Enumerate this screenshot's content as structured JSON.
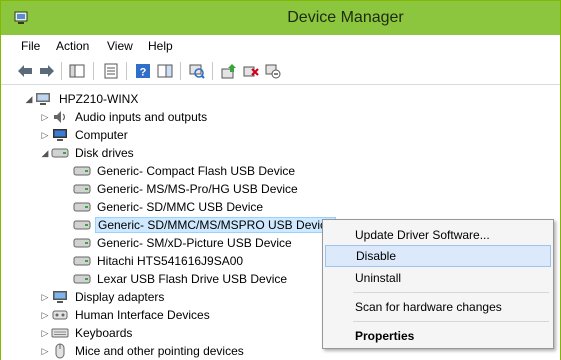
{
  "window": {
    "title": "Device Manager",
    "accent": "#8cc63f"
  },
  "menu": [
    "File",
    "Action",
    "View",
    "Help"
  ],
  "toolbar": {
    "buttons": [
      "back-icon",
      "forward-icon",
      "show-hide-console-tree-icon",
      "properties-icon",
      "help-icon",
      "action-pane-icon",
      "scan-for-hardware-changes-icon",
      "update-driver-icon",
      "uninstall-icon",
      "disable-device-icon"
    ]
  },
  "tree": {
    "root": "HPZ210-WINX",
    "categories": {
      "audio": "Audio inputs and outputs",
      "computer": "Computer",
      "disk": "Disk drives",
      "display": "Display adapters",
      "hid": "Human Interface Devices",
      "keyboards": "Keyboards",
      "mice": "Mice and other pointing devices"
    },
    "disk_drives": [
      "Generic- Compact Flash USB Device",
      "Generic- MS/MS-Pro/HG USB Device",
      "Generic- SD/MMC USB Device",
      "Generic- SD/MMC/MS/MSPRO USB Device",
      "Generic- SM/xD-Picture USB Device",
      "Hitachi HTS541616J9SA00",
      "Lexar USB Flash Drive USB Device"
    ]
  },
  "context_menu": {
    "update": "Update Driver Software...",
    "disable": "Disable",
    "uninstall": "Uninstall",
    "scan": "Scan for hardware changes",
    "properties": "Properties"
  }
}
